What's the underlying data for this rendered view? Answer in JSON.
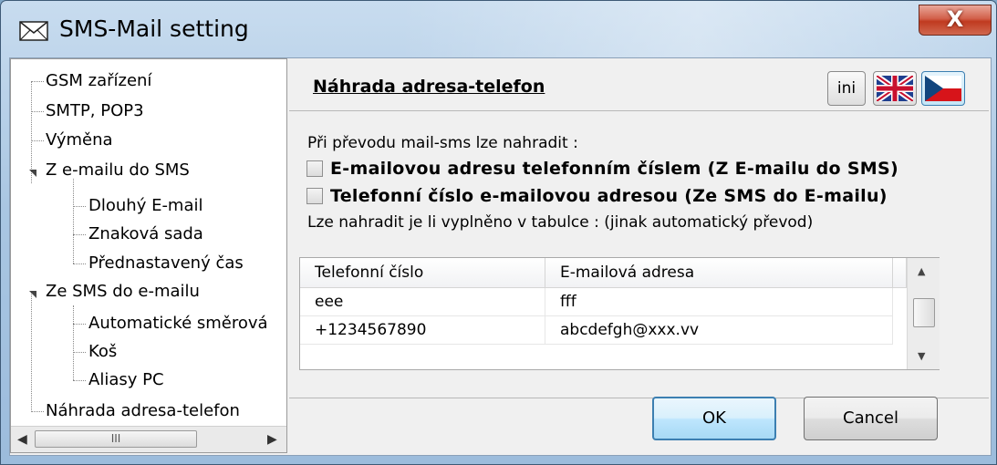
{
  "window": {
    "title": "SMS-Mail setting",
    "close_glyph": "X"
  },
  "tree": {
    "items": [
      {
        "label": "GSM zařízení"
      },
      {
        "label": "SMTP, POP3"
      },
      {
        "label": "Výměna"
      },
      {
        "label": "Z e-mailu do SMS"
      },
      {
        "label": "Dlouhý E-mail"
      },
      {
        "label": "Znaková sada"
      },
      {
        "label": "Přednastavený čas"
      },
      {
        "label": "Ze SMS do e-mailu"
      },
      {
        "label": "Automatické směrová"
      },
      {
        "label": "Koš"
      },
      {
        "label": "Aliasy PC"
      },
      {
        "label": "Náhrada adresa-telefon"
      }
    ],
    "scroll_thumb_glyph": "III"
  },
  "panel": {
    "title": "Náhrada adresa-telefon",
    "ini_label": "ini",
    "intro": "Při převodu mail-sms lze nahradit :",
    "options": [
      {
        "label": "E-mailovou adresu telefonním číslem (Z E-mailu do SMS)",
        "checked": false
      },
      {
        "label": "Telefonní číslo e-mailovou adresou (Ze SMS do E-mailu)",
        "checked": false
      }
    ],
    "note": "Lze nahradit je li vyplněno v tabulce : (jinak automatický převod)"
  },
  "table": {
    "columns": [
      "Telefonní číslo",
      "E-mailová adresa"
    ],
    "rows": [
      [
        "eee",
        "fff"
      ],
      [
        "+1234567890",
        "abcdefgh@xxx.vv"
      ]
    ]
  },
  "buttons": {
    "ok": "OK",
    "cancel": "Cancel"
  }
}
